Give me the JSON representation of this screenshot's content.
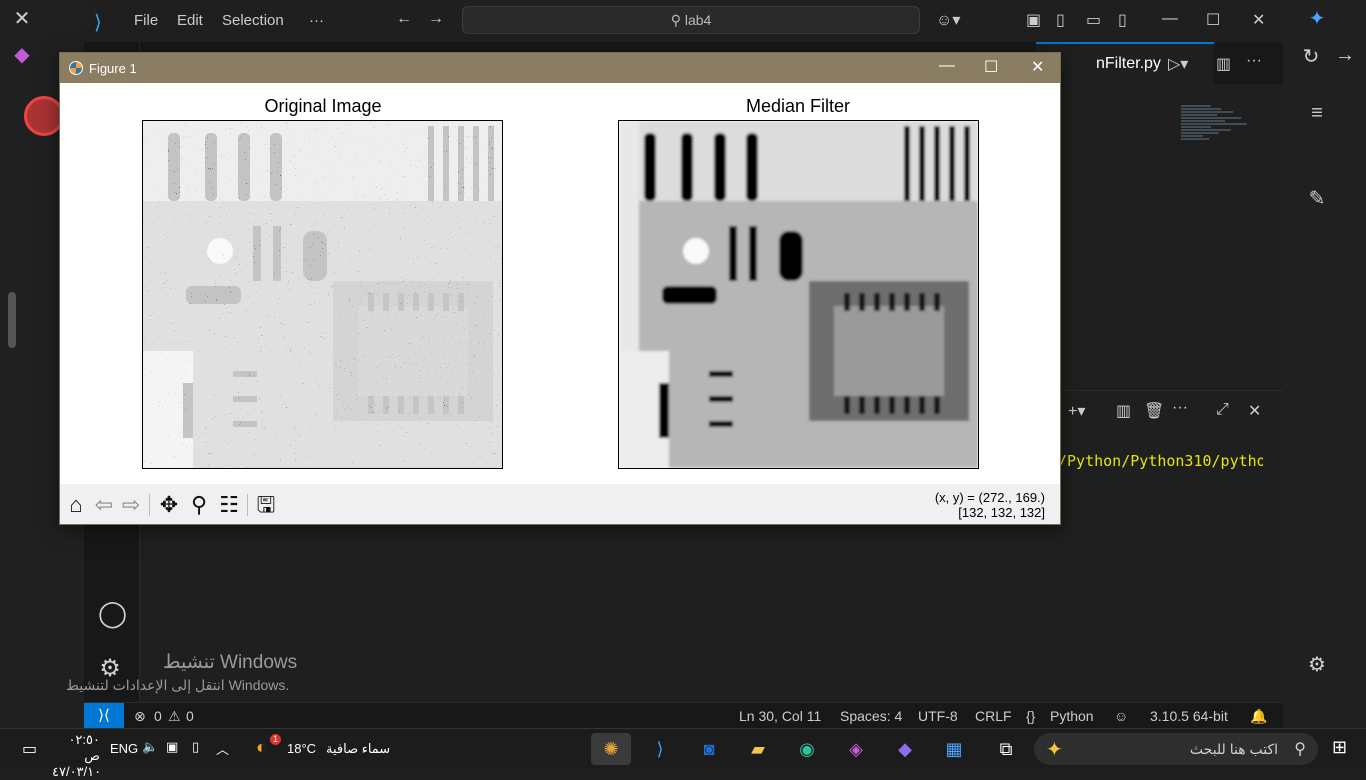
{
  "figure": {
    "window_title": "Figure 1",
    "controls": {
      "minimize": "—",
      "maximize": "☐",
      "close": "✕"
    },
    "plots": [
      {
        "title": "Original Image"
      },
      {
        "title": "Median Filter"
      }
    ],
    "toolbar": {
      "home_icon": "⌂",
      "back_icon": "⇦",
      "forward_icon": "⇨",
      "pan_icon": "✥",
      "zoom_icon": "⚲",
      "configure_icon": "☷",
      "save_icon": "🖫"
    },
    "coords": {
      "xy": "(x, y) = (272., 169.)",
      "value": "[132, 132, 132]"
    }
  },
  "vscode": {
    "menu": [
      "File",
      "Edit",
      "Selection",
      "···"
    ],
    "search": "lab4",
    "tab_label": "nFilter.py",
    "terminal_text": "/Python/Python310/pytho",
    "status": {
      "errors": "0",
      "warnings": "0",
      "position": "Ln 30, Col 11",
      "spaces": "Spaces: 4",
      "encoding": "UTF-8",
      "eol": "CRLF",
      "language": "Python",
      "interpreter": "3.10.5 64-bit"
    }
  },
  "watermark": {
    "line1": "تنشيط Windows",
    "line2": "انتقل إلى الإعدادات لتنشيط Windows."
  },
  "taskbar": {
    "time": "٠٢:٥٠ ص",
    "date": "٤٧/٠٣/١٠",
    "language": "ENG",
    "temperature": "18°C",
    "weather": "سماء صافية",
    "search_placeholder": "اكتب هنا للبحث",
    "weather_badge": "1"
  },
  "colors": {
    "accent": "#0078d4",
    "figure_titlebar": "#8a7d62",
    "terminal_yellow": "#e5e510"
  }
}
